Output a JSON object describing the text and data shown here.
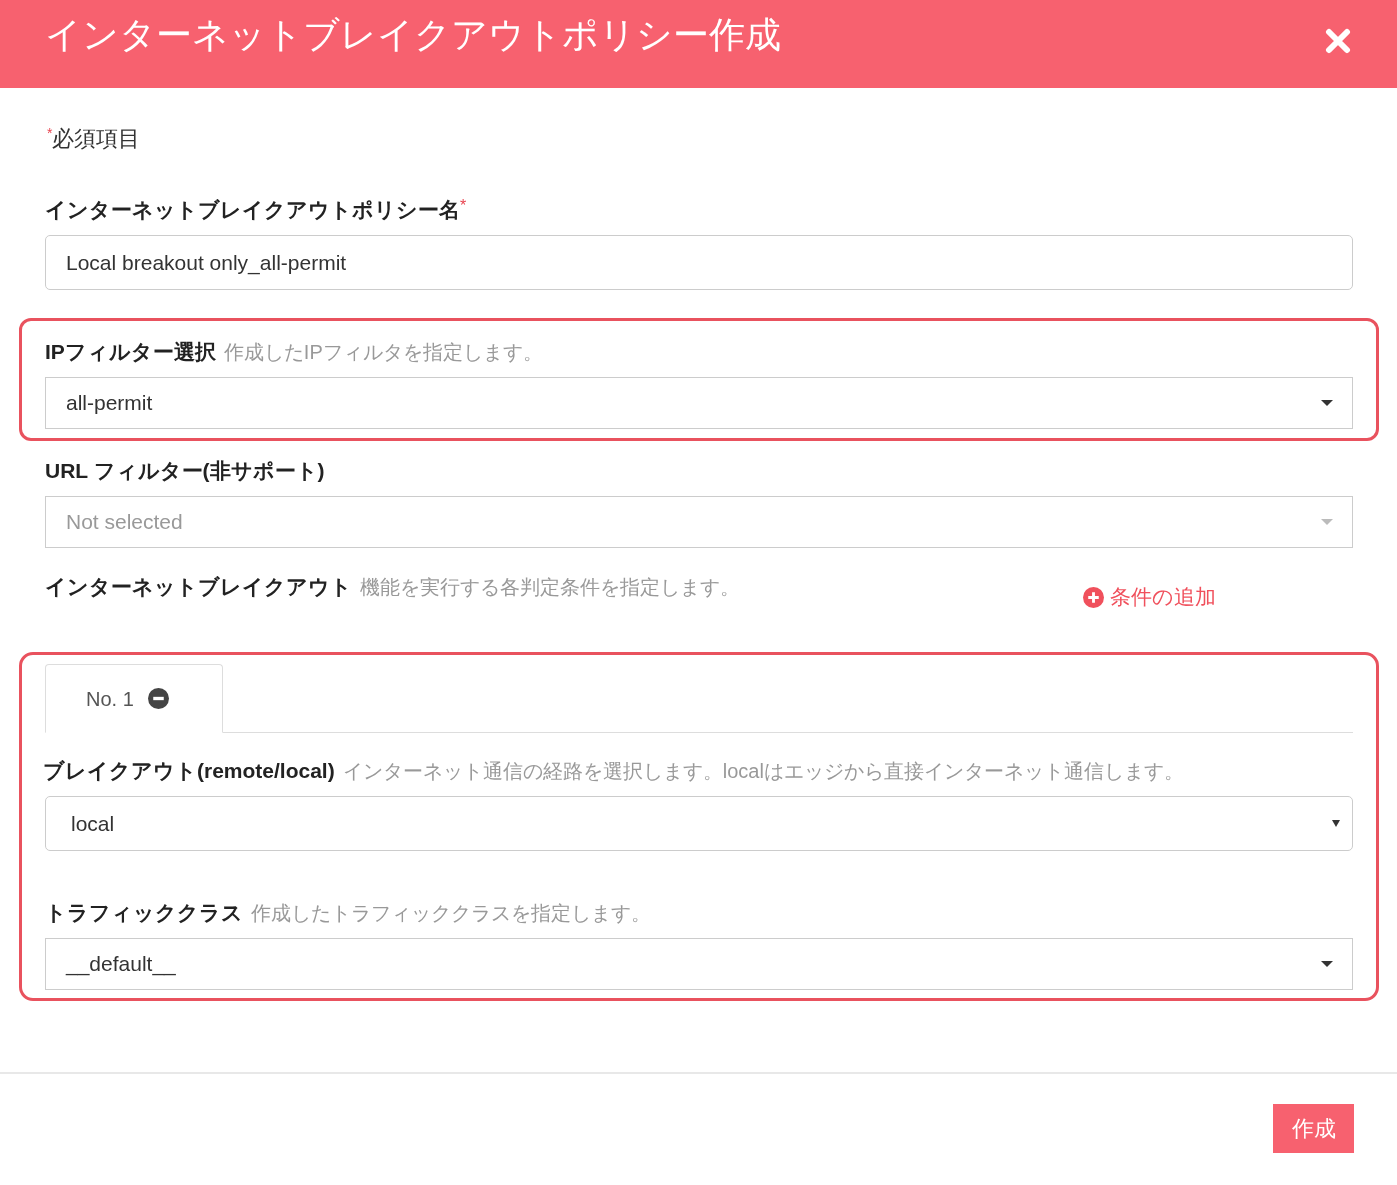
{
  "header": {
    "title": "インターネットブレイクアウトポリシー作成"
  },
  "required_note": {
    "mark": "*",
    "text": "必須項目"
  },
  "policy_name": {
    "label": "インターネットブレイクアウトポリシー名",
    "required_mark": "*",
    "value": "Local breakout only_all-permit"
  },
  "ip_filter": {
    "label": "IPフィルター選択",
    "hint": "作成したIPフィルタを指定します。",
    "value": "all-permit",
    "highlighted": true
  },
  "url_filter": {
    "label": "URL フィルター(非サポート)",
    "placeholder": "Not selected",
    "disabled": true
  },
  "conditions": {
    "label": "インターネットブレイクアウト",
    "hint": "機能を実行する各判定条件を指定します。",
    "add_link": "条件の追加"
  },
  "condition_panel": {
    "highlighted": true,
    "tabs": [
      {
        "label": "No. 1",
        "selected": true
      }
    ],
    "fields": [
      {
        "kind": "native-select",
        "label": "ブレイクアウト(remote/local)",
        "hint": "インターネット通信の経路を選択します。localはエッジから直接インターネット通信します。",
        "value": "local"
      },
      {
        "kind": "select",
        "label": "トラフィッククラス",
        "hint": "作成したトラフィッククラスを指定します。",
        "value": "__default__"
      }
    ]
  },
  "footer": {
    "submit": "作成"
  }
}
